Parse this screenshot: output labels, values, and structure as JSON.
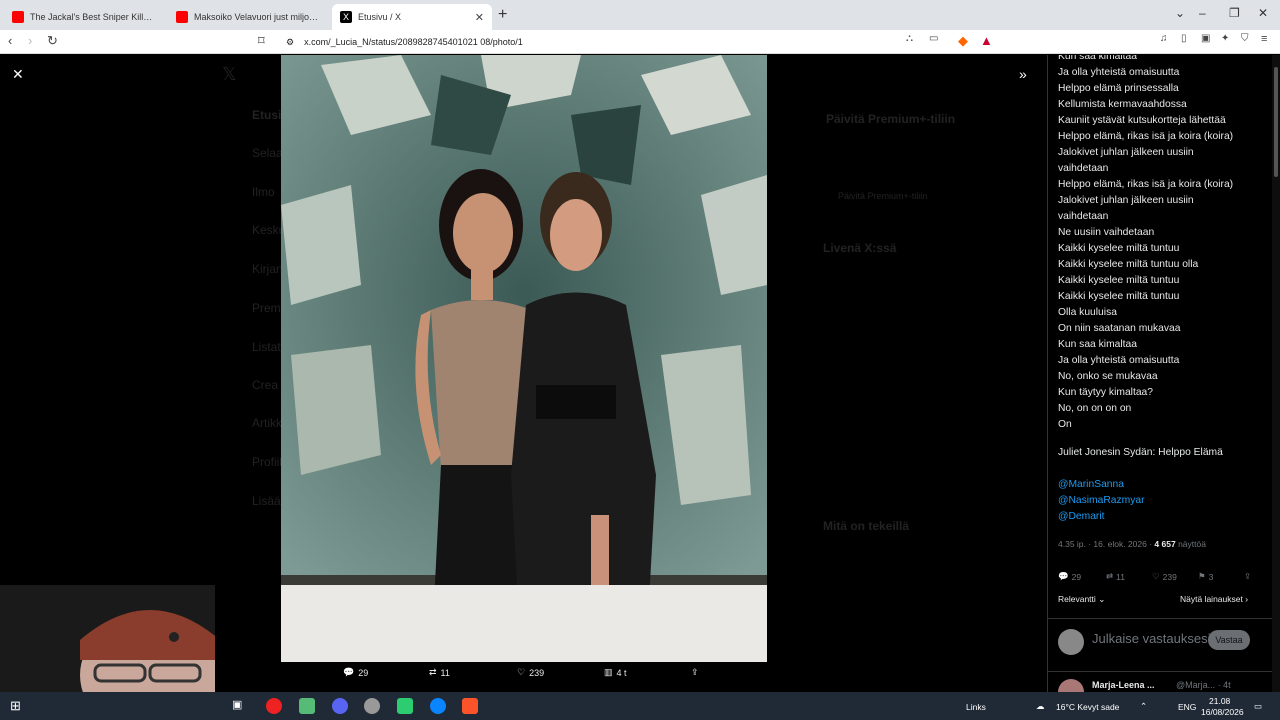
{
  "browser": {
    "tabs": [
      {
        "title": "The Jackal's Best Sniper Kills | The Da",
        "icon": "youtube-icon"
      },
      {
        "title": "Maksoiko Velavuori just miljoonan vi",
        "icon": "youtube-icon"
      },
      {
        "title": "Etusivu / X",
        "icon": "x-icon"
      }
    ],
    "url": "x.com/_Lucia_N/status/2089828745401021 08/photo/1"
  },
  "background_nav": [
    "Etusi",
    "Selaa",
    "Ilmo",
    "Keskus",
    "Kirjan",
    "Prem",
    "Listat",
    "Crea",
    "Artikk",
    "Profiili",
    "Lisää"
  ],
  "background_right": {
    "premium_title": "Päivitä Premium+-tiliin",
    "premium_button": "Päivitä Premium+-tiliin",
    "trending_title": "Livenä X:ssä",
    "whats_happening": "Mitä on tekeillä"
  },
  "photo_actions": {
    "replies": "29",
    "reposts": "11",
    "likes": "239",
    "views": "4 t"
  },
  "tweet": {
    "lines": [
      "Kun saa kimaltaa",
      "Ja olla yhteistä omaisuutta",
      "Helppo elämä prinsessalla",
      "Kellumista kermavaahdossa",
      "Kauniit ystävät kutsukortteja lähettää",
      "Helppo elämä, rikas isä ja koira (koira)",
      "Jalokivet juhlan jälkeen uusiin",
      "vaihdetaan",
      "Helppo elämä, rikas isä ja koira (koira)",
      "Jalokivet juhlan jälkeen uusiin",
      "vaihdetaan",
      "Ne uusiin vaihdetaan",
      "Kaikki kyselee miltä tuntuu",
      "Kaikki kyselee miltä tuntuu olla",
      "Kaikki kyselee miltä tuntuu",
      "Kaikki kyselee miltä tuntuu",
      "Olla kuuluisa",
      "On niin saatanan mukavaa",
      "Kun saa kimaltaa",
      "Ja olla yhteistä omaisuutta",
      "No, onko se mukavaa",
      "Kun täytyy kimaltaa?",
      "No, on on on on",
      "On"
    ],
    "credit": "Juliet Jonesin Sydän: Helppo Elämä",
    "mentions": [
      "@MarinSanna",
      "@NasimaRazmyar",
      "@Demarit"
    ],
    "time": "4.35 ip. · 16. elok. 2026 ·",
    "views_count": "4 657",
    "views_label": "näyttöä",
    "replies": "29",
    "reposts": "11",
    "likes": "239",
    "bookmarks": "3",
    "sort_label": "Relevantti",
    "quotes_label": "Näytä lainaukset",
    "compose_placeholder": "Julkaise vastauksesi",
    "reply_button": "Vastaa",
    "reply_author": "Marja-Leena ...",
    "reply_handle": "@Marja... · 4t"
  },
  "taskbar": {
    "links": "Links",
    "weather": "16°C  Kevyt sade",
    "lang": "ENG",
    "time": "21.08",
    "date": "16/08/2026"
  }
}
